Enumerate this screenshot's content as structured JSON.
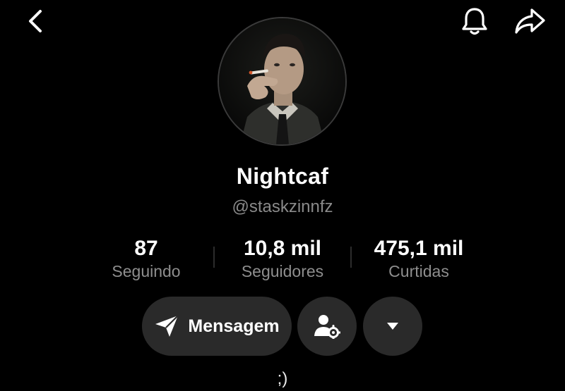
{
  "header": {
    "back_icon": "chevron-left-icon",
    "bell_icon": "bell-icon",
    "share_icon": "share-arrow-icon"
  },
  "profile": {
    "display_name": "Nightcaf",
    "username": "@staskzinnfz",
    "bio": ";)"
  },
  "stats": [
    {
      "value": "87",
      "label": "Seguindo"
    },
    {
      "value": "10,8 mil",
      "label": "Seguidores"
    },
    {
      "value": "475,1 mil",
      "label": "Curtidas"
    }
  ],
  "actions": {
    "message_label": "Mensagem",
    "message_icon": "paper-plane-icon",
    "follow_settings_icon": "user-gear-icon",
    "more_icon": "caret-down-icon"
  },
  "colors": {
    "background": "#000000",
    "button_bg": "#2a2a2a",
    "muted_text": "#8e8e8e"
  }
}
